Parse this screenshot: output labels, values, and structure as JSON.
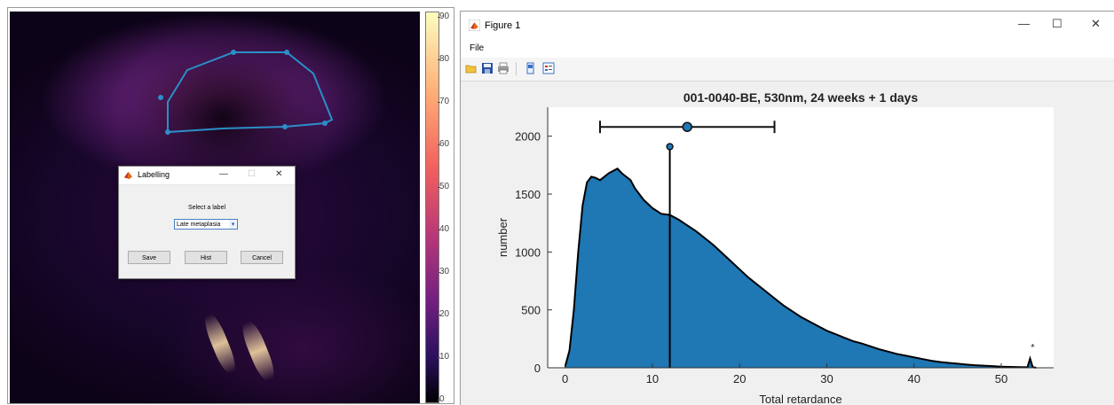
{
  "image_viewer": {
    "colorbar_ticks": [
      "90",
      "80",
      "70",
      "60",
      "50",
      "40",
      "30",
      "20",
      "10",
      "0"
    ],
    "colormap": [
      "#000004",
      "#2c115f",
      "#721f81",
      "#b5367a",
      "#f1605d",
      "#feb078",
      "#fcfdbf"
    ]
  },
  "dialog": {
    "title": "Labelling",
    "minimize": "—",
    "maximize": "☐",
    "close": "✕",
    "prompt": "Select a label",
    "select_value": "Late metaplasia",
    "save_label": "Save",
    "hist_label": "Hist",
    "cancel_label": "Cancel"
  },
  "figure_window": {
    "title": "Figure 1",
    "minimize": "—",
    "maximize": "☐",
    "close": "✕",
    "menu_file": "File",
    "toolbar_icons": [
      "open-folder-icon",
      "save-icon",
      "print-icon",
      "data-cursor-icon",
      "insert-legend-icon"
    ]
  },
  "chart_data": {
    "type": "area",
    "title": "001-0040-BE, 530nm, 24 weeks +  1 days",
    "xlabel": "Total retardance",
    "ylabel": "number",
    "xlim": [
      -2,
      56
    ],
    "ylim": [
      0,
      2250
    ],
    "xticks": [
      0,
      10,
      20,
      30,
      40,
      50
    ],
    "yticks": [
      0,
      500,
      1000,
      1500,
      2000
    ],
    "fill_color": "#1f77b4",
    "line_color": "#000000",
    "x": [
      0,
      0.5,
      1,
      1.5,
      2,
      2.5,
      3,
      3.5,
      4,
      4.5,
      5,
      5.5,
      6,
      6.5,
      7,
      7.5,
      8,
      9,
      10,
      11,
      12,
      13,
      14,
      15,
      16,
      17,
      18,
      19,
      20,
      21,
      22,
      23,
      24,
      25,
      26,
      27,
      28,
      29,
      30,
      31,
      32,
      33,
      34,
      35,
      36,
      37,
      38,
      39,
      40,
      41,
      42,
      43,
      44,
      45,
      46,
      47,
      48,
      49,
      50,
      51,
      52,
      53,
      53.3,
      53.6,
      54
    ],
    "y": [
      10,
      150,
      500,
      1000,
      1400,
      1600,
      1650,
      1640,
      1620,
      1650,
      1680,
      1700,
      1720,
      1680,
      1650,
      1620,
      1550,
      1450,
      1380,
      1330,
      1320,
      1280,
      1230,
      1180,
      1120,
      1060,
      990,
      920,
      850,
      780,
      720,
      660,
      600,
      540,
      490,
      440,
      400,
      360,
      320,
      290,
      260,
      230,
      210,
      185,
      160,
      140,
      120,
      105,
      90,
      75,
      60,
      50,
      42,
      35,
      28,
      22,
      18,
      14,
      10,
      8,
      6,
      5,
      80,
      6,
      0
    ],
    "error_bar": {
      "center": 14,
      "low": 4,
      "high": 24,
      "y": 2080
    },
    "median_line": {
      "x": 12,
      "top": 1910
    },
    "annotation": "*"
  }
}
